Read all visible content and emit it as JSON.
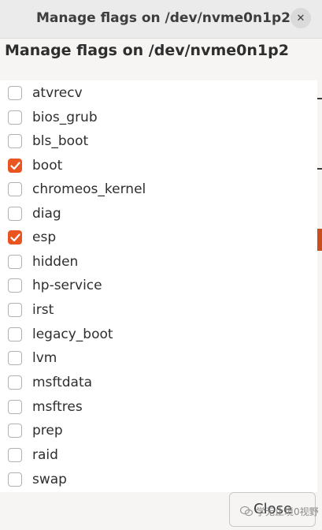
{
  "window": {
    "title": "Manage flags on /dev/nvme0n1p2",
    "close_glyph": "✕"
  },
  "heading": "Manage flags on /dev/nvme0n1p2",
  "flags": [
    {
      "label": "atvrecv",
      "checked": false
    },
    {
      "label": "bios_grub",
      "checked": false
    },
    {
      "label": "bls_boot",
      "checked": false
    },
    {
      "label": "boot",
      "checked": true
    },
    {
      "label": "chromeos_kernel",
      "checked": false
    },
    {
      "label": "diag",
      "checked": false
    },
    {
      "label": "esp",
      "checked": true
    },
    {
      "label": "hidden",
      "checked": false
    },
    {
      "label": "hp-service",
      "checked": false
    },
    {
      "label": "irst",
      "checked": false
    },
    {
      "label": "legacy_boot",
      "checked": false
    },
    {
      "label": "lvm",
      "checked": false
    },
    {
      "label": "msftdata",
      "checked": false
    },
    {
      "label": "msftres",
      "checked": false
    },
    {
      "label": "prep",
      "checked": false
    },
    {
      "label": "raid",
      "checked": false
    },
    {
      "label": "swap",
      "checked": false
    }
  ],
  "buttons": {
    "close_label": "Close"
  },
  "watermark": "学无止境0视野",
  "colors": {
    "accent": "#e95420",
    "titlebar": "#ebebeb",
    "list_bg": "#ffffff",
    "window_bg": "#f6f5f4"
  }
}
